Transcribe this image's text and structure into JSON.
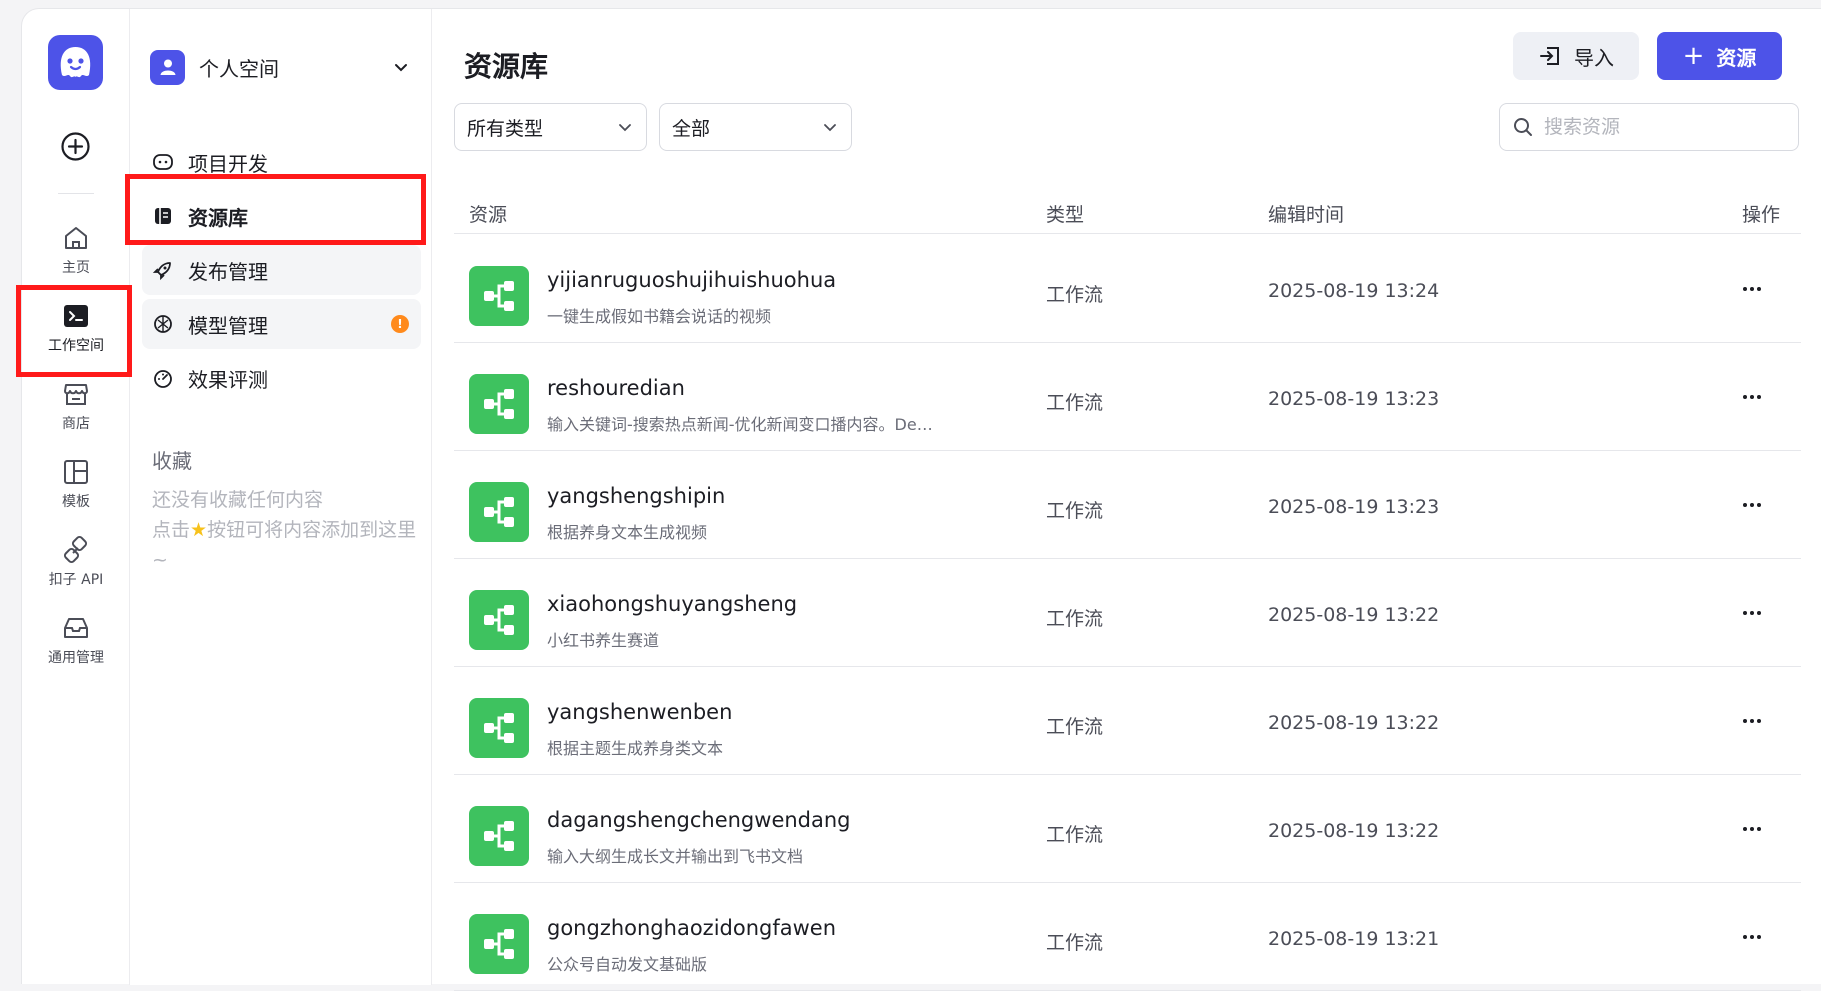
{
  "rail": {
    "items": [
      {
        "label": "主页",
        "icon": "home-icon"
      },
      {
        "label": "工作空间",
        "icon": "terminal-icon"
      },
      {
        "label": "商店",
        "icon": "store-icon"
      },
      {
        "label": "模板",
        "icon": "template-icon"
      },
      {
        "label": "扣子 API",
        "icon": "api-link-icon"
      },
      {
        "label": "通用管理",
        "icon": "inbox-icon"
      }
    ]
  },
  "subnav": {
    "space_name": "个人空间",
    "items": [
      {
        "label": "项目开发",
        "icon": "project-icon"
      },
      {
        "label": "资源库",
        "icon": "library-icon"
      },
      {
        "label": "发布管理",
        "icon": "rocket-icon"
      },
      {
        "label": "模型管理",
        "icon": "model-icon",
        "badge": "!"
      },
      {
        "label": "效果评测",
        "icon": "gauge-icon"
      }
    ],
    "favorites_title": "收藏",
    "favorites_empty_1": "还没有收藏任何内容",
    "favorites_empty_2a": "点击",
    "favorites_empty_2b": "按钮可将内容添加到这里~"
  },
  "main": {
    "title": "资源库",
    "import_label": "导入",
    "add_label": "资源",
    "filter_type": "所有类型",
    "filter_scope": "全部",
    "search_placeholder": "搜索资源",
    "columns": {
      "resource": "资源",
      "type": "类型",
      "edited": "编辑时间",
      "actions": "操作"
    },
    "rows": [
      {
        "name": "yijianruguoshujihuishuohua",
        "desc": "一键生成假如书籍会说话的视频",
        "type": "工作流",
        "time": "2025-08-19 13:24"
      },
      {
        "name": "reshouredian",
        "desc": "输入关键词-搜索热点新闻-优化新闻变口播内容。De…",
        "type": "工作流",
        "time": "2025-08-19 13:23"
      },
      {
        "name": "yangshengshipin",
        "desc": "根据养身文本生成视频",
        "type": "工作流",
        "time": "2025-08-19 13:23"
      },
      {
        "name": "xiaohongshuyangsheng",
        "desc": "小红书养生赛道",
        "type": "工作流",
        "time": "2025-08-19 13:22"
      },
      {
        "name": "yangshenwenben",
        "desc": "根据主题生成养身类文本",
        "type": "工作流",
        "time": "2025-08-19 13:22"
      },
      {
        "name": "dagangshengchengwendang",
        "desc": "输入大纲生成长文并输出到飞书文档",
        "type": "工作流",
        "time": "2025-08-19 13:22"
      },
      {
        "name": "gongzhonghaozidongfawen",
        "desc": "公众号自动发文基础版",
        "type": "工作流",
        "time": "2025-08-19 13:21"
      }
    ]
  },
  "colors": {
    "brand": "#4d53e8",
    "workflow": "#3ec25f",
    "annotation": "#ff1a1a",
    "warn": "#ff8a1c"
  }
}
